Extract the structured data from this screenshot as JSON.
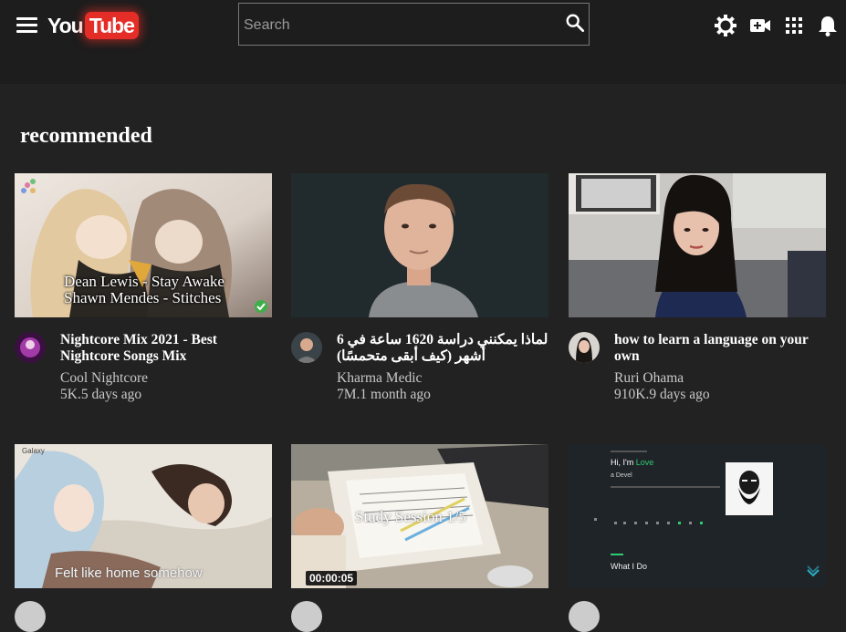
{
  "header": {
    "logo_you": "You",
    "logo_tube": "Tube",
    "search": {
      "placeholder": "Search",
      "value": ""
    },
    "icons": [
      "menu-icon",
      "search-icon",
      "theme-icon",
      "create-video-icon",
      "apps-icon",
      "notifications-icon"
    ]
  },
  "main": {
    "section_title": "recommended",
    "videos": [
      {
        "title": "Nightcore Mix 2021 - Best Nightcore Songs Mix",
        "channel": "Cool Nightcore",
        "meta": "5K.5 days ago",
        "overlay_line1": "Dean Lewis - Stay Awake",
        "overlay_line2": "Shawn Mendes - Stitches"
      },
      {
        "title": "لماذا يمكنني دراسة 1620 ساعة في 6 أشهر (كيف أبقى متحمسًا)",
        "channel": "Kharma Medic",
        "meta": "7M.1 month ago"
      },
      {
        "title": "how to learn a language on your own",
        "channel": "Ruri Ohama",
        "meta": "910K.9 days ago"
      },
      {
        "overlay_text": "Felt like home somehow",
        "overlay_corner": "Galaxy"
      },
      {
        "overlay_text": "Study Session 1/5",
        "duration": "00:00:05"
      },
      {
        "hero_greeting": "Hi, I'm",
        "hero_name": "Love",
        "hero_sub": "a Devel",
        "section_label": "What I Do"
      }
    ]
  },
  "colors": {
    "header_bg": "#1d1d1d",
    "page_bg": "#222222",
    "logo_red": "#e52d27",
    "portfolio_accent": "#2ecc71"
  }
}
